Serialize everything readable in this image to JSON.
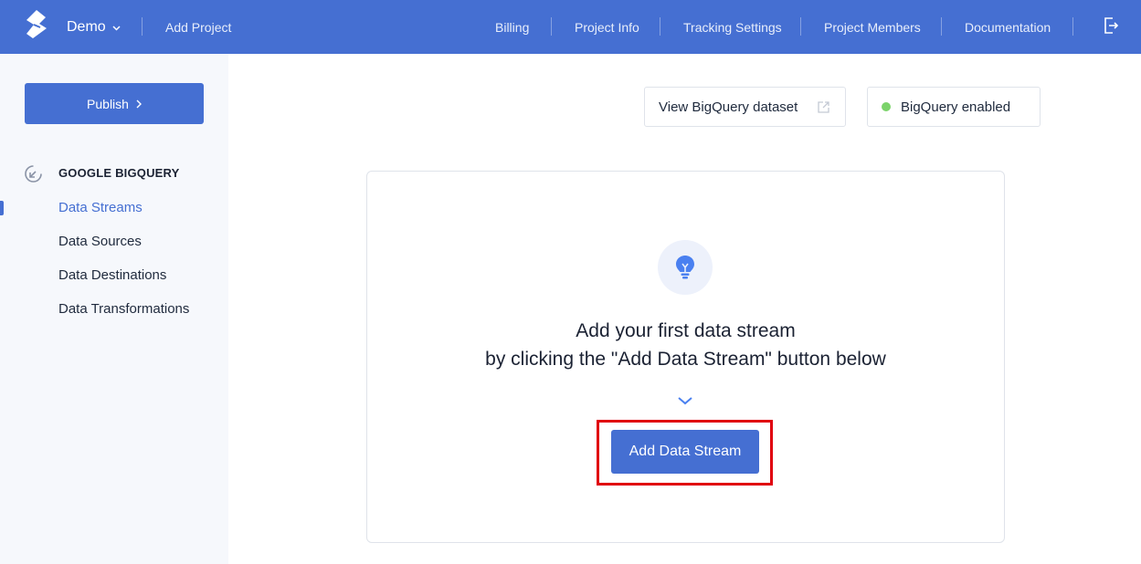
{
  "topbar": {
    "project_name": "Demo",
    "add_project_label": "Add Project",
    "nav": [
      "Billing",
      "Project Info",
      "Tracking Settings",
      "Project Members",
      "Documentation"
    ],
    "accent_color": "#456fd2"
  },
  "sidebar": {
    "publish_label": "Publish",
    "section_title": "GOOGLE BIGQUERY",
    "items": [
      {
        "label": "Data Streams",
        "active": true
      },
      {
        "label": "Data Sources",
        "active": false
      },
      {
        "label": "Data Destinations",
        "active": false
      },
      {
        "label": "Data Transformations",
        "active": false
      }
    ]
  },
  "main": {
    "view_dataset_label": "View BigQuery dataset",
    "status_label": "BigQuery enabled",
    "status_color": "#7bd36a",
    "empty_line1": "Add your first data stream",
    "empty_line2": "by clicking the \"Add Data Stream\" button below",
    "add_stream_label": "Add Data Stream",
    "highlight_color": "#e0000f"
  }
}
